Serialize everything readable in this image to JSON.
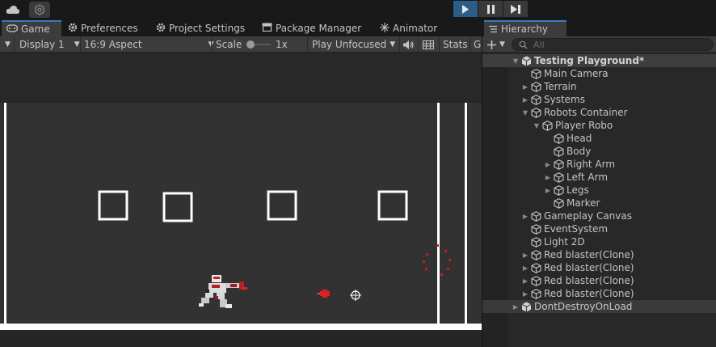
{
  "topbar": {
    "cloud_icon": "cloud-icon",
    "collab_icon": "collab-icon",
    "play_icon": "play-icon",
    "pause_icon": "pause-icon",
    "step_icon": "step-icon",
    "accent": "#2c5d87"
  },
  "tabs": [
    {
      "label": "Game",
      "icon": "gamepad-icon"
    },
    {
      "label": "Preferences",
      "icon": "gear-icon"
    },
    {
      "label": "Project Settings",
      "icon": "gear-icon"
    },
    {
      "label": "Package Manager",
      "icon": "package-icon"
    },
    {
      "label": "Animator",
      "icon": "animator-icon"
    }
  ],
  "game_toolbar": {
    "display": "Display 1",
    "aspect": "16:9 Aspect",
    "scale_label": "Scale",
    "scale_value": "1x",
    "play_mode": "Play Unfocused",
    "stats": "Stats",
    "gizmos": "G"
  },
  "hierarchy": {
    "tab_label": "Hierarchy",
    "search_placeholder": "All",
    "items": [
      {
        "label": "Testing Playground*",
        "depth": 0,
        "fold": "open",
        "kind": "scene"
      },
      {
        "label": "Main Camera",
        "depth": 1,
        "fold": "none",
        "kind": "object"
      },
      {
        "label": "Terrain",
        "depth": 1,
        "fold": "closed",
        "kind": "object"
      },
      {
        "label": "Systems",
        "depth": 1,
        "fold": "closed",
        "kind": "object"
      },
      {
        "label": "Robots Container",
        "depth": 1,
        "fold": "open",
        "kind": "object"
      },
      {
        "label": "Player Robo",
        "depth": 2,
        "fold": "open",
        "kind": "object"
      },
      {
        "label": "Head",
        "depth": 3,
        "fold": "none",
        "kind": "object"
      },
      {
        "label": "Body",
        "depth": 3,
        "fold": "none",
        "kind": "object"
      },
      {
        "label": "Right Arm",
        "depth": 3,
        "fold": "closed",
        "kind": "object"
      },
      {
        "label": "Left Arm",
        "depth": 3,
        "fold": "closed",
        "kind": "object"
      },
      {
        "label": "Legs",
        "depth": 3,
        "fold": "closed",
        "kind": "object"
      },
      {
        "label": "Marker",
        "depth": 3,
        "fold": "none",
        "kind": "object"
      },
      {
        "label": "Gameplay Canvas",
        "depth": 1,
        "fold": "closed",
        "kind": "object"
      },
      {
        "label": "EventSystem",
        "depth": 1,
        "fold": "none",
        "kind": "object"
      },
      {
        "label": "Light 2D",
        "depth": 1,
        "fold": "none",
        "kind": "object"
      },
      {
        "label": "Red blaster(Clone)",
        "depth": 1,
        "fold": "closed",
        "kind": "object"
      },
      {
        "label": "Red blaster(Clone)",
        "depth": 1,
        "fold": "closed",
        "kind": "object"
      },
      {
        "label": "Red blaster(Clone)",
        "depth": 1,
        "fold": "closed",
        "kind": "object"
      },
      {
        "label": "Red blaster(Clone)",
        "depth": 1,
        "fold": "closed",
        "kind": "object"
      },
      {
        "label": "DontDestroyOnLoad",
        "depth": 0,
        "fold": "closed",
        "kind": "dontdestroy"
      }
    ]
  }
}
